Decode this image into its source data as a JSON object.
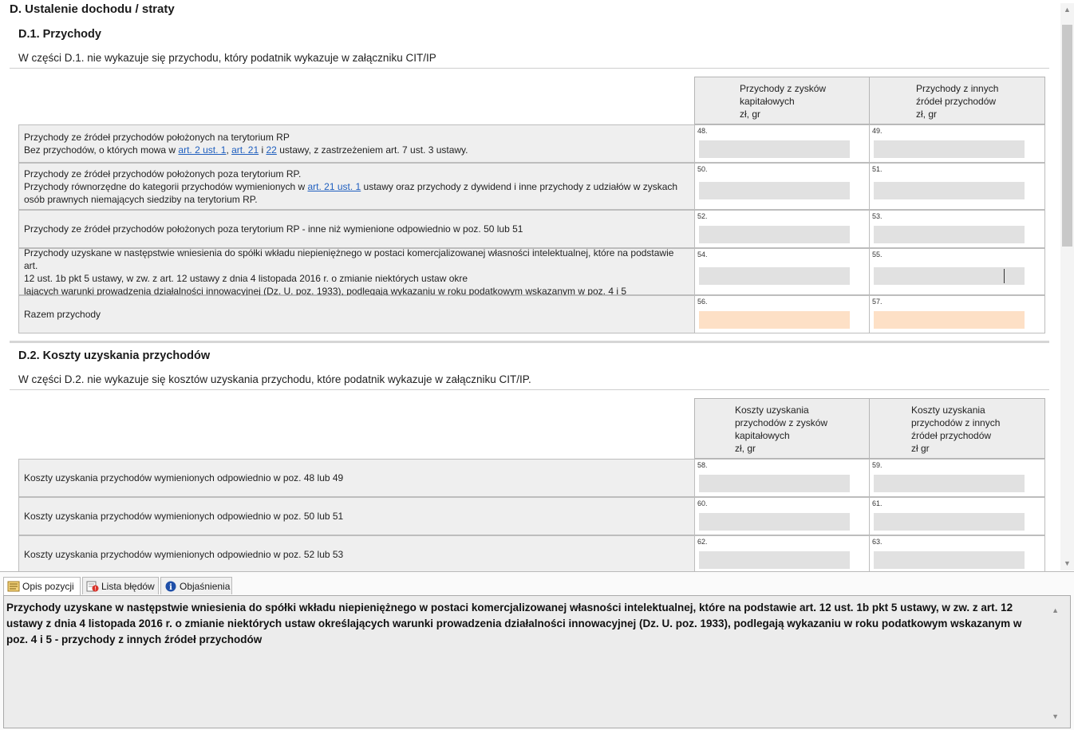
{
  "section": {
    "title": "D. Ustalenie dochodu / straty"
  },
  "d1": {
    "title": "D.1. Przychody",
    "note": "W części D.1. nie wykazuje się przychodu, który podatnik wykazuje w załączniku CIT/IP",
    "col1_header": "Przychody z zysków\nkapitałowych\nzł, gr",
    "col2_header": "Przychody z innych\nźródeł przychodów\nzł, gr",
    "rows": [
      {
        "line1": "Przychody ze źródeł przychodów położonych na terytorium RP",
        "line2_pre": "Bez przychodów, o których mowa w ",
        "link1": "art. 2 ust. 1",
        "sep1": ", ",
        "link2": "art. 21",
        "sep2": " i ",
        "link3": "22",
        "line2_post": " ustawy, z zastrzeżeniem art. 7 ust. 3 ustawy.",
        "num1": "48.",
        "num2": "49."
      },
      {
        "line1": "Przychody ze źródeł przychodów położonych poza terytorium RP.",
        "line2_pre": "Przychody równorzędne do kategorii przychodów wymienionych w ",
        "link1": "art. 21 ust. 1",
        "line2_post": " ustawy oraz przychody z dywidend i inne przychody z udziałów w zyskach",
        "line3": "osób prawnych niemających siedziby na terytorium RP.",
        "num1": "50.",
        "num2": "51."
      },
      {
        "line1": "Przychody ze źródeł przychodów położonych poza terytorium RP - inne niż wymienione odpowiednio w poz. 50 lub 51",
        "num1": "52.",
        "num2": "53."
      },
      {
        "line1": "Przychody uzyskane w następstwie wniesienia do spółki wkładu niepieniężnego w postaci komercjalizowanej własności intelektualnej, które na podstawie art.",
        "line2": "12 ust. 1b pkt 5 ustawy, w zw. z art. 12 ustawy z dnia 4 listopada 2016 r. o zmianie niektórych ustaw okre",
        "line3": "lających warunki prowadzenia działalności innowacyjnej (Dz. U. poz. 1933), podlegają wykazaniu w roku podatkowym wskazanym w poz. 4 i 5",
        "num1": "54.",
        "num2": "55."
      },
      {
        "line1": "Razem przychody",
        "num1": "56.",
        "num2": "57."
      }
    ]
  },
  "d2": {
    "title": "D.2. Koszty uzyskania przychodów",
    "note": "W części D.2. nie wykazuje się kosztów uzyskania przychodu, które podatnik wykazuje w załączniku CIT/IP.",
    "col1_header": "Koszty uzyskania\nprzychodów z zysków\nkapitałowych\nzł, gr",
    "col2_header": "Koszty uzyskania\nprzychodów z innych\nźródeł przychodów\nzł gr",
    "rows": [
      {
        "line1": "Koszty uzyskania przychodów wymienionych odpowiednio w poz. 48 lub 49",
        "num1": "58.",
        "num2": "59."
      },
      {
        "line1": "Koszty uzyskania przychodów wymienionych odpowiednio w poz. 50 lub 51",
        "num1": "60.",
        "num2": "61."
      },
      {
        "line1": "Koszty uzyskania przychodów wymienionych odpowiednio w poz. 52 lub 53",
        "num1": "62.",
        "num2": "63."
      }
    ]
  },
  "bottom": {
    "tabs": [
      "Opis pozycji",
      "Lista błędów",
      "Objaśnienia"
    ],
    "description": "Przychody uzyskane w następstwie wniesienia do spółki wkładu niepieniężnego w postaci komercjalizowanej własności intelektualnej, które na podstawie art. 12 ust. 1b pkt 5 ustawy, w zw. z art. 12 ustawy z dnia 4 listopada 2016 r. o zmianie niektórych ustaw określających warunki prowadzenia działalności innowacyjnej (Dz. U. poz. 1933), podlegają wykazaniu w roku podatkowym wskazanym w poz. 4 i 5 - przychody z innych źródeł przychodów"
  },
  "colors": {
    "field": "#e1e1e1",
    "total_field": "#fde0c6",
    "link": "#1f5fbf"
  }
}
